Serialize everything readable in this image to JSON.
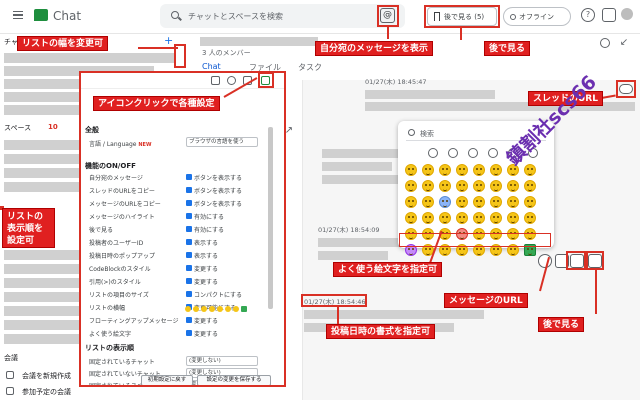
{
  "app": {
    "name": "Chat"
  },
  "search": {
    "placeholder": "チャットとスペースを検索"
  },
  "topbar": {
    "mention_icon": "@",
    "later_label": "後で見る (5)",
    "status_label": "オフライン"
  },
  "sidebar": {
    "chat_heading": "チャット",
    "spaces_heading": "スペース",
    "spaces_count": "10",
    "meetings_heading": "会議",
    "new_meeting": "会議を新規作成",
    "upcoming": "参加予定の会議"
  },
  "main": {
    "members": "3 人のメンバー",
    "tabs": [
      "Chat",
      "ファイル",
      "タスク"
    ],
    "timestamps": [
      "01/27(木) 18:45:47",
      "01/27(木) 18:54:09",
      "01/27(木) 18:54:46"
    ]
  },
  "emoji_popup": {
    "search_label": "検索"
  },
  "settings": {
    "section_general": "全般",
    "language_label": "言語 / Language",
    "language_new_badge": "NEW",
    "language_value": "ブラウザの言語を使う",
    "section_features": "機能のON/OFF",
    "features": [
      {
        "label": "自分宛のメッセージ",
        "value": "ボタンを表示する"
      },
      {
        "label": "スレッドのURLをコピー",
        "value": "ボタンを表示する"
      },
      {
        "label": "メッセージのURLをコピー",
        "value": "ボタンを表示する"
      },
      {
        "label": "メッセージのハイライト",
        "value": "有効にする"
      },
      {
        "label": "後で見る",
        "value": "有効にする"
      },
      {
        "label": "投稿者のユーザーID",
        "value": "表示する"
      },
      {
        "label": "投稿日時のポップアップ",
        "value": "表示する"
      },
      {
        "label": "CodeBlockのスタイル",
        "value": "変更する"
      },
      {
        "label": "引用(>)のスタイル",
        "value": "変更する"
      },
      {
        "label": "リストの項目のサイズ",
        "value": "コンパクトにする"
      },
      {
        "label": "リストの横幅",
        "value": "変更可能にする"
      },
      {
        "label": "フローティングアップメッセージ",
        "value": "変更する"
      },
      {
        "label": "よく使う絵文字",
        "value": "変更する"
      }
    ],
    "section_list": "リストの表示順",
    "list_order": [
      {
        "label": "固定されているチャット",
        "value": "(変更しない)"
      },
      {
        "label": "固定されていないチャット",
        "value": "(変更しない)"
      },
      {
        "label": "固定されているスペース",
        "value": "(変更しない)"
      }
    ],
    "reset_button": "初期設定に戻す",
    "save_button": "設定の変更を保存する"
  },
  "callouts": {
    "resize_list": "リストの幅を変更可",
    "mentions": "自分宛のメッセージを表示",
    "watch_later_top": "後で見る",
    "icon_settings": "アイコンクリックで各種設定",
    "thread_url": "スレッドのURL",
    "list_order": "リストの表示順を設定可",
    "frequent_emoji": "よく使う絵文字を指定可",
    "message_url": "メッセージのURL",
    "watch_later_msg": "後で見る",
    "timestamp_format": "投稿日時の書式を指定可"
  },
  "watermark": "鎮割社scs66"
}
